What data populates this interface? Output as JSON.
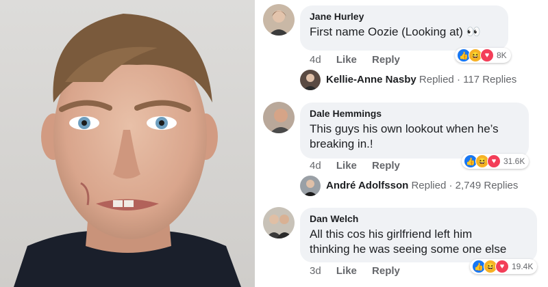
{
  "comments": [
    {
      "author": "Jane Hurley",
      "text": "First name Oozie (Looking at) 👀",
      "time": "4d",
      "like_label": "Like",
      "reply_label": "Reply",
      "reaction_count": "8K",
      "reply": {
        "name": "Kellie-Anne Nasby",
        "replied_label": "Replied",
        "count": "117 Replies"
      }
    },
    {
      "author": "Dale Hemmings",
      "text_line1": "This guys his own lookout when he’s",
      "text_line2": "breaking in.!",
      "time": "4d",
      "like_label": "Like",
      "reply_label": "Reply",
      "reaction_count": "31.6K",
      "reply": {
        "name": "André Adolfsson",
        "replied_label": "Replied",
        "count": "2,749 Replies"
      }
    },
    {
      "author": "Dan Welch",
      "text_line1": "All this cos his girlfriend left him",
      "text_line2": "thinking he was seeing some one else",
      "time": "3d",
      "like_label": "Like",
      "reply_label": "Reply",
      "reaction_count": "19.4K"
    }
  ],
  "colors": {
    "bubble": "#f0f2f5",
    "like_blue": "#1877f2",
    "love_red": "#f33e58",
    "haha_yellow": "#f7b125",
    "meta_gray": "#65676b"
  },
  "icons": {
    "like": "thumbs-up-icon",
    "haha": "laughing-face-icon",
    "love": "heart-icon"
  }
}
